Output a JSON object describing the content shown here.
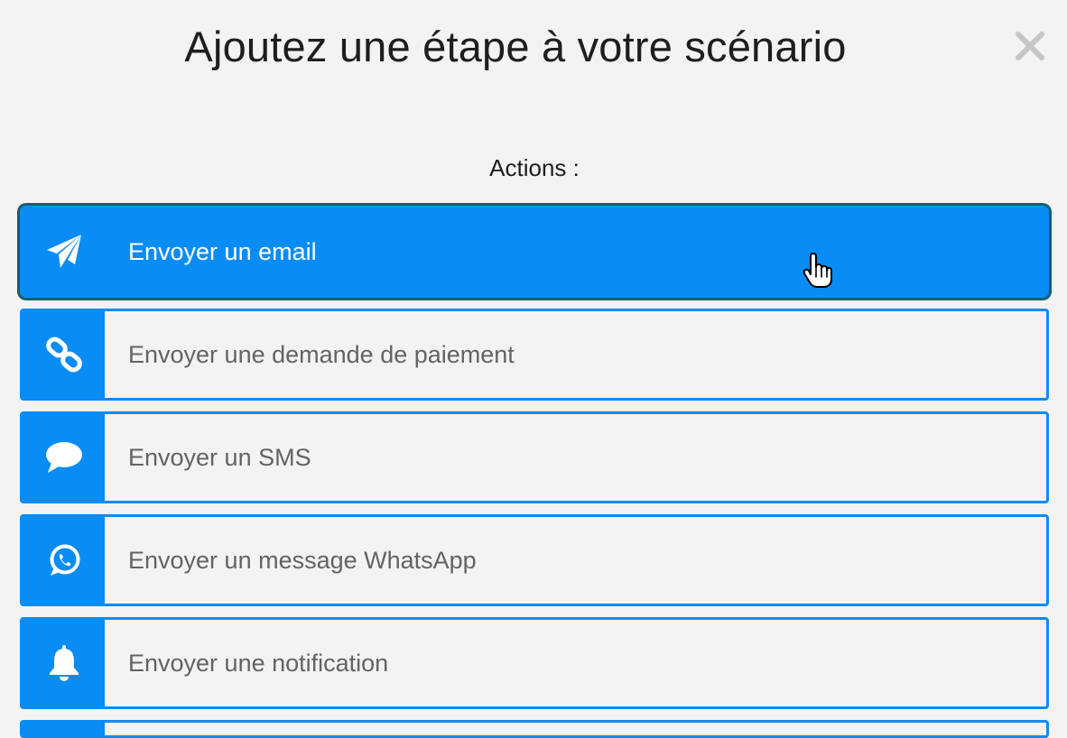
{
  "modal": {
    "title": "Ajoutez une étape à votre scénario",
    "close_icon": "close-icon"
  },
  "actions": {
    "label": "Actions :",
    "items": [
      {
        "label": "Envoyer un email",
        "icon": "paper-plane-icon",
        "state": "hovered"
      },
      {
        "label": "Envoyer une demande de paiement",
        "icon": "link-icon"
      },
      {
        "label": "Envoyer un SMS",
        "icon": "chat-bubble-icon"
      },
      {
        "label": "Envoyer un message WhatsApp",
        "icon": "whatsapp-icon"
      },
      {
        "label": "Envoyer une notification",
        "icon": "bell-icon"
      }
    ]
  },
  "colors": {
    "accent": "#0a8cf5",
    "hover_outline": "#17606a",
    "background": "#f3f3f3",
    "title_text": "#1e1e1e",
    "item_text": "#636363",
    "close_icon": "#c6c6c6"
  }
}
